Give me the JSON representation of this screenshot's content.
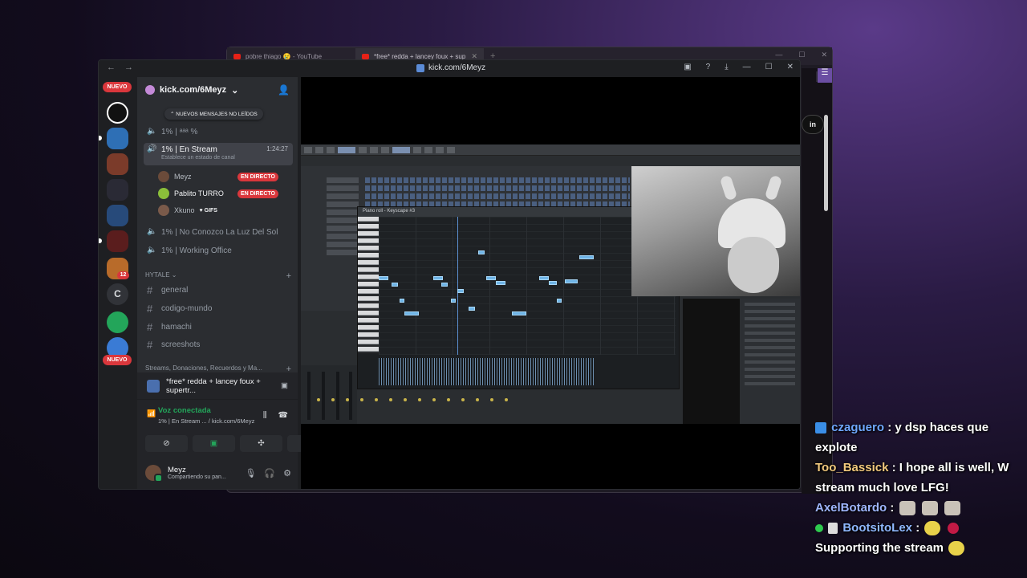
{
  "browser": {
    "tabs": [
      {
        "label": "pobre thiago 😢 - YouTube"
      },
      {
        "label": "*free* redda + lancey foux + sup"
      }
    ],
    "badge": "2",
    "login": "in"
  },
  "discord": {
    "title": "kick.com/6Meyz",
    "rail": {
      "new_top": "NUEVO",
      "new_bottom": "NUEVO",
      "badge_count": "12",
      "letter_server": "C"
    },
    "server_name": "kick.com/6Meyz",
    "unread_pill": "NUEVOS MENSAJES NO LEÍDOS",
    "channels": {
      "c1": "1% | \u0000\u0000\u0000 %",
      "selected": {
        "name": "1% | En Stream",
        "timer": "1:24:27",
        "status": "Establece un estado de canal"
      },
      "voice_users": [
        {
          "name": "Meyz",
          "tag": "EN DIRECTO"
        },
        {
          "name": "Pablito TURRO",
          "tag": "EN DIRECTO"
        },
        {
          "name": "Xkuno",
          "tag": "GIFS"
        }
      ],
      "c2": "1% | No Conozco La Luz Del Sol",
      "c3": "1% | Working Office"
    },
    "category": "HYTALE",
    "text_channels": [
      "general",
      "codigo-mundo",
      "hamachi",
      "screeshots"
    ],
    "category2": "Streams, Donaciones, Recuerdos y Ma...",
    "panel": {
      "stream_title": "*free* redda + lancey foux + supertr...",
      "voice_status": "Voz conectada",
      "voice_channel": "1% | En Stream ... / kick.com/6Meyz",
      "username": "Meyz",
      "user_status": "Compartiendo su pan..."
    }
  },
  "daw": {
    "piano_roll_title": "Piano roll - Keyscape #3"
  },
  "chat": [
    {
      "user": "czaguero",
      "color": "#6fa8ff",
      "message": ": y dsp haces que explote"
    },
    {
      "user": "Too_Bassick",
      "color": "#f2c97d",
      "message": ": I hope all is well, W stream much love LFG!"
    },
    {
      "user": "AxelBotardo",
      "color": "#9fb6ff",
      "message": ":"
    },
    {
      "user": "BootsitoLex",
      "color": "#8fb8ff",
      "message": ":"
    },
    {
      "user": "",
      "color": "#ffffff",
      "message": "Supporting the stream"
    }
  ]
}
